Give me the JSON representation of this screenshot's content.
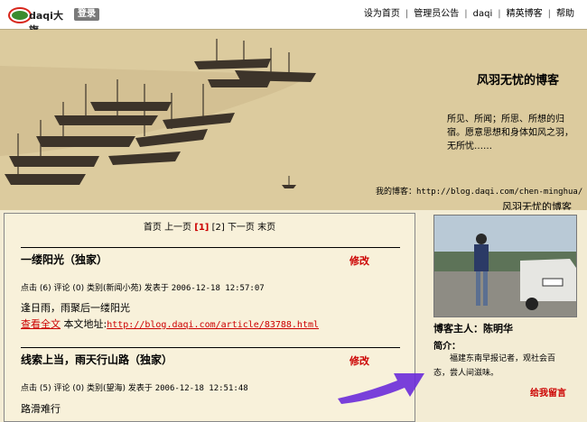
{
  "header": {
    "logo_text": "daqi大旗",
    "login_button": "登录",
    "nav": [
      "设为首页",
      "管理员公告",
      "daqi",
      "精英博客",
      "帮助"
    ]
  },
  "banner": {
    "title": "风羽无忧的博客",
    "intro": "所见、所闻；所思、所想的归宿。愿意思想和身体如风之羽，无所忧……",
    "url_label": "我的博客：",
    "url": "http://blog.daqi.com/chen-minghua/",
    "name_repeat": "风羽无忧的博客"
  },
  "pager": {
    "first": "首页",
    "prev": "上一页",
    "page1": "1",
    "page2": "2",
    "next": "下一页",
    "last": "末页"
  },
  "posts": [
    {
      "title": "一缕阳光（独家）",
      "edit": "修改",
      "meta_stats": "点击 (6) 评论 (0) 类别(新闻小苑) 发表于",
      "date": "2006-12-18 12:57:07",
      "excerpt": "逢日雨，雨聚后一缕阳光",
      "read_more": "查看全文",
      "addr_label": "本文地址:",
      "addr": "http://blog.daqi.com/article/83788.html"
    },
    {
      "title": "线索上当，雨天行山路（独家）",
      "edit": "修改",
      "meta_stats": "点击 (5) 评论 (0) 类别(望海) 发表于",
      "date": "2006-12-18 12:51:48",
      "excerpt": "路滑难行"
    }
  ],
  "sidebar": {
    "owner": "博客主人：陈明华",
    "bio_label": "简介：",
    "bio": "福建东南早报记者，观社会百态，尝人间滋味。",
    "leave_message": "给我留言"
  },
  "colors": {
    "accent": "#cc0000",
    "arrow": "#6a2bd9",
    "background": "#f3ecd4"
  }
}
